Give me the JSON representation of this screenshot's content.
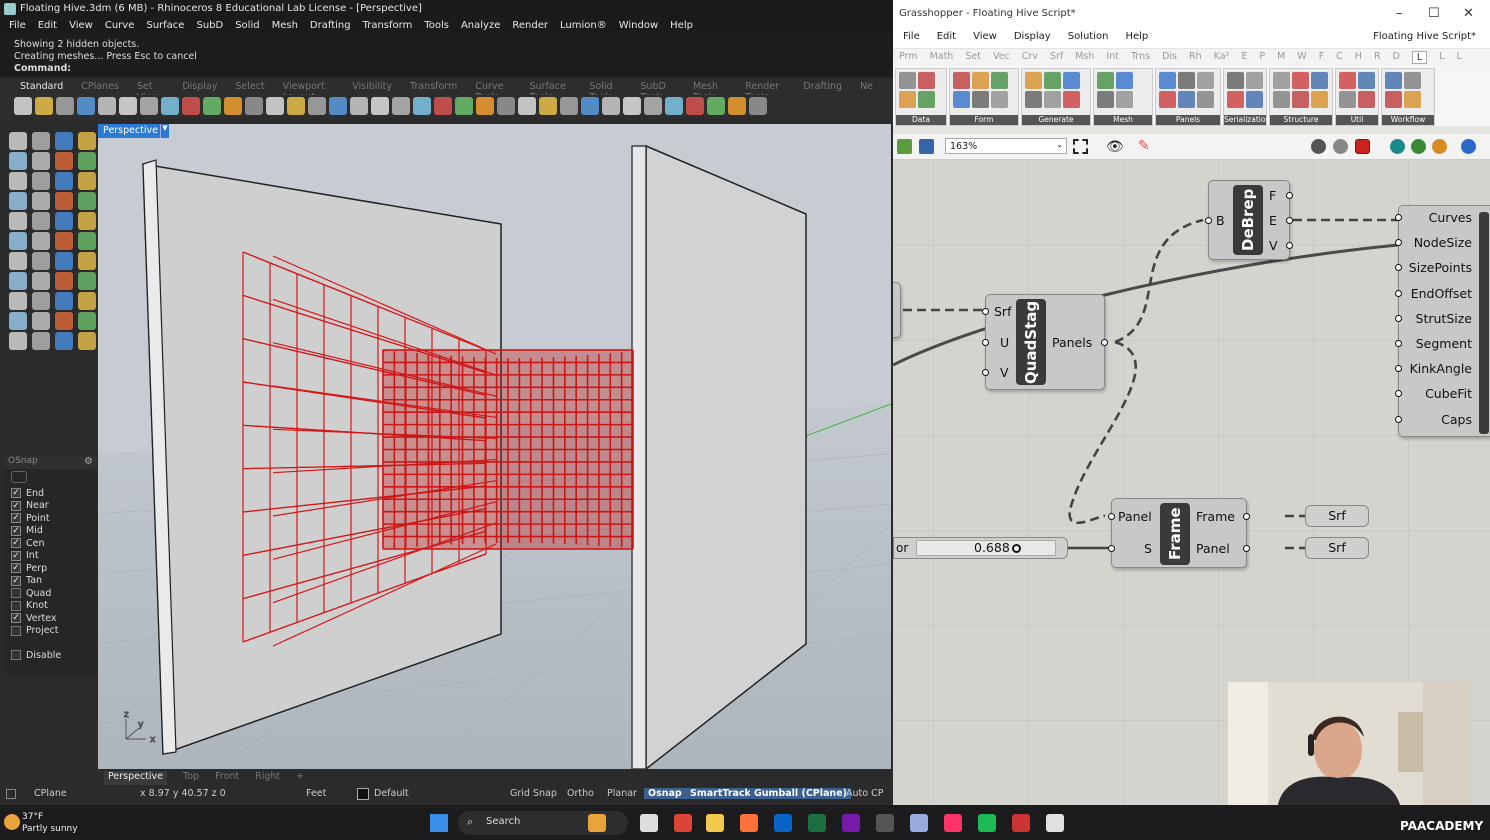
{
  "rhino": {
    "title": "Floating Hive.3dm (6 MB) - Rhinoceros 8 Educational Lab License - [Perspective]",
    "menu": [
      "File",
      "Edit",
      "View",
      "Curve",
      "Surface",
      "SubD",
      "Solid",
      "Mesh",
      "Drafting",
      "Transform",
      "Tools",
      "Analyze",
      "Render",
      "Lumion®",
      "Window",
      "Help"
    ],
    "command_history": [
      "Showing 2 hidden objects.",
      "Creating meshes... Press Esc to cancel"
    ],
    "command_prompt": "Command:",
    "toolbar_tabs": [
      "Standard",
      "CPlanes",
      "Set View",
      "Display",
      "Select",
      "Viewport Layout",
      "Visibility",
      "Transform",
      "Curve Tools",
      "Surface Tools",
      "Solid Tools",
      "SubD Tools",
      "Mesh Tools",
      "Render Tools",
      "Drafting",
      "Ne"
    ],
    "viewport_label": "Perspective",
    "viewport_tabs": [
      "Perspective",
      "Top",
      "Front",
      "Right",
      "+"
    ],
    "osnap": {
      "title": "OSnap",
      "items": [
        {
          "label": "End",
          "checked": true
        },
        {
          "label": "Near",
          "checked": true
        },
        {
          "label": "Point",
          "checked": true
        },
        {
          "label": "Mid",
          "checked": true
        },
        {
          "label": "Cen",
          "checked": true
        },
        {
          "label": "Int",
          "checked": true
        },
        {
          "label": "Perp",
          "checked": true
        },
        {
          "label": "Tan",
          "checked": true
        },
        {
          "label": "Quad",
          "checked": false
        },
        {
          "label": "Knot",
          "checked": false
        },
        {
          "label": "Vertex",
          "checked": true
        },
        {
          "label": "Project",
          "checked": false
        }
      ],
      "disable": "Disable"
    },
    "status": {
      "cplane": "CPlane",
      "coords": "x 8.97  y 40.57  z 0",
      "units": "Feet",
      "layer": "Default",
      "grid_snap": "Grid Snap",
      "ortho": "Ortho",
      "planar": "Planar",
      "osnap": "Osnap",
      "smarttrack": "SmartTrack",
      "gumball": "Gumball (CPlane)",
      "auto": "Auto CP"
    },
    "axis": {
      "x": "x",
      "y": "y",
      "z": "z"
    }
  },
  "grasshopper": {
    "title": "Grasshopper - Floating Hive Script*",
    "menu": [
      "File",
      "Edit",
      "View",
      "Display",
      "Solution",
      "Help"
    ],
    "doc_name": "Floating Hive Script*",
    "categories": [
      "Prm",
      "Math",
      "Set",
      "Vec",
      "Crv",
      "Srf",
      "Msh",
      "Int",
      "Trns",
      "Dis",
      "Rh",
      "Ka²",
      "E",
      "P",
      "M",
      "W",
      "F",
      "C",
      "H",
      "R",
      "D",
      "L",
      "L",
      "L"
    ],
    "active_category_index": 21,
    "ribbon_groups": [
      "Data",
      "Form",
      "Generate",
      "Mesh",
      "Panels",
      "Serialization",
      "Structure",
      "Util",
      "Workflow"
    ],
    "zoom": "163%",
    "components": {
      "debrep": {
        "nick": "DeBrep",
        "inputs": [
          "B"
        ],
        "outputs": [
          "F",
          "E",
          "V"
        ]
      },
      "quadstag": {
        "nick": "QuadStag",
        "inputs": [
          "Srf",
          "U",
          "V"
        ],
        "outputs": [
          "Panels"
        ]
      },
      "frame": {
        "nick": "Frame",
        "inputs": [
          "Panel",
          "S"
        ],
        "outputs": [
          "Frame",
          "Panel"
        ]
      },
      "hive": {
        "inputs": [
          "Curves",
          "NodeSize",
          "SizePoints",
          "EndOffset",
          "StrutSize",
          "Segment",
          "KinkAngle",
          "CubeFit",
          "Caps"
        ]
      },
      "slider": {
        "label": "or",
        "value": "0.688"
      },
      "srf_params": [
        "Srf",
        "Srf"
      ]
    }
  },
  "taskbar": {
    "temp": "37°F",
    "weather": "Partly sunny",
    "search": "Search",
    "brand": "PAACADEMY"
  },
  "colors": {
    "mesh_red": "#d41818",
    "viewport_bg": "#c6ccd2",
    "gh_canvas": "#d4d4cf",
    "active_blue": "#2b7bd4"
  }
}
